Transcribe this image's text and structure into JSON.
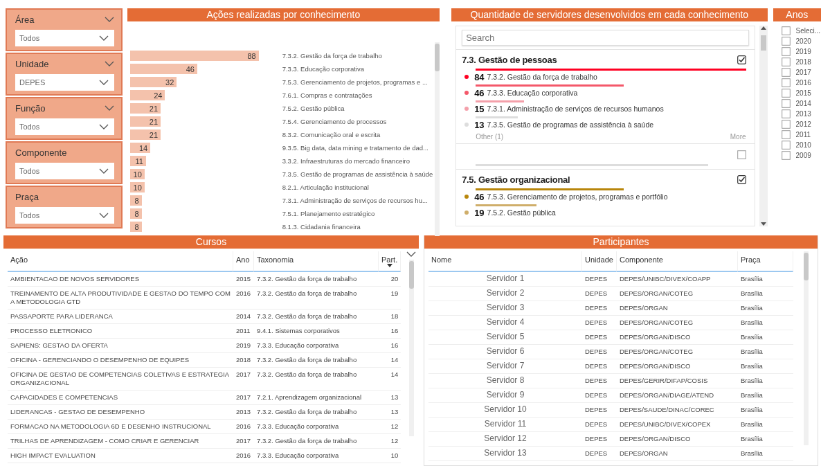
{
  "filters": [
    {
      "label": "Área",
      "value": "Todos",
      "collapse_caret": true
    },
    {
      "label": "Unidade",
      "value": "DEPES",
      "collapse_caret": true
    },
    {
      "label": "Função",
      "value": "Todos",
      "collapse_caret": true
    },
    {
      "label": "Componente",
      "value": "Todos",
      "collapse_caret": false
    },
    {
      "label": "Praça",
      "value": "Todos",
      "collapse_caret": false
    }
  ],
  "actions_chart": {
    "title": "Ações realizadas por conhecimento",
    "chart_data": {
      "type": "bar",
      "orientation": "horizontal",
      "data_labels": true,
      "categories": [
        "7.3.2. Gestão da força de trabalho",
        "7.3.3. Educação corporativa",
        "7.5.3. Gerenciamento de projetos, programas e ...",
        "7.6.1. Compras e contratações",
        "7.5.2. Gestão pública",
        "7.5.4. Gerenciamento de processos",
        "8.3.2. Comunicação oral e escrita",
        "9.3.5. Big data, data mining e tratamento de dad...",
        "3.3.2. Infraestruturas do mercado financeiro",
        "7.3.5. Gestão de programas de assistência à saúde",
        "8.2.1. Articulação institucional",
        "7.3.1. Administração de serviços de recursos hu...",
        "7.5.1. Planejamento estratégico",
        "8.1.3. Cidadania financeira"
      ],
      "series": [
        {
          "color": "#f4c2ac",
          "values": [
            88,
            46,
            32,
            24,
            21,
            21,
            21,
            14,
            11,
            10,
            10,
            8,
            8,
            8
          ]
        }
      ]
    }
  },
  "knowledge": {
    "title": "Quantidade de servidores desenvolvidos em cada conhecimento",
    "search": {
      "placeholder": "Search"
    },
    "groups": [
      {
        "name": "7.3. Gestão de pessoas",
        "checked": true,
        "other": "Other (1)",
        "more": "More",
        "items": [
          {
            "count": "84",
            "label": "7.3.2. Gestão da força de trabalho",
            "color": "#ff0022"
          },
          {
            "count": "46",
            "label": "7.3.3. Educação corporativa",
            "color": "#f4586a"
          },
          {
            "count": "15",
            "label": "7.3.1. Administração de serviços de recursos humanos",
            "color": "#f4a0aa"
          },
          {
            "count": "13",
            "label": "7.3.5. Gestão de programas de assistência à saúde",
            "color": "#dddddd"
          }
        ]
      },
      {
        "checked": false
      },
      {
        "name": "7.5. Gestão organizacional",
        "checked": true,
        "items": [
          {
            "count": "46",
            "label": "7.5.3. Gerenciamento de projetos, programas e portfólio",
            "color": "#b8860b"
          },
          {
            "count": "19",
            "label": "7.5.2. Gestão pública",
            "color": "#cfae6a"
          }
        ]
      }
    ]
  },
  "years": {
    "title": "Anos",
    "items": [
      {
        "label": "Seleci...",
        "checked": false
      },
      {
        "label": "2020",
        "checked": false
      },
      {
        "label": "2019",
        "checked": false
      },
      {
        "label": "2018",
        "checked": false
      },
      {
        "label": "2017",
        "checked": false
      },
      {
        "label": "2016",
        "checked": false
      },
      {
        "label": "2015",
        "checked": false
      },
      {
        "label": "2014",
        "checked": false
      },
      {
        "label": "2013",
        "checked": false
      },
      {
        "label": "2012",
        "checked": false
      },
      {
        "label": "2011",
        "checked": false
      },
      {
        "label": "2010",
        "checked": false
      },
      {
        "label": "2009",
        "checked": false
      }
    ]
  },
  "courses": {
    "title": "Cursos",
    "columns": [
      {
        "label": "Ação",
        "sorted": false
      },
      {
        "label": "Ano",
        "sorted": false
      },
      {
        "label": "Taxonomia",
        "sorted": false
      },
      {
        "label": "Part.",
        "sorted": true
      }
    ],
    "rows": [
      [
        "AMBIENTACAO DE NOVOS SERVIDORES",
        "2015",
        "7.3.2. Gestão da força de trabalho",
        "20"
      ],
      [
        "TREINAMENTO DE ALTA PRODUTIVIDADE E GESTAO DO TEMPO COM A METODOLOGIA GTD",
        "2016",
        "7.3.2. Gestão da força de trabalho",
        "19"
      ],
      [
        "PASSAPORTE PARA LIDERANCA",
        "2014",
        "7.3.2. Gestão da força de trabalho",
        "18"
      ],
      [
        "PROCESSO ELETRONICO",
        "2011",
        "9.4.1. Sistemas corporativos",
        "16"
      ],
      [
        "SAPIENS: GESTAO DA OFERTA",
        "2019",
        "7.3.3. Educação corporativa",
        "16"
      ],
      [
        "OFICINA - GERENCIANDO O DESEMPENHO DE EQUIPES",
        "2018",
        "7.3.2. Gestão da força de trabalho",
        "14"
      ],
      [
        "OFICINA DE GESTAO DE COMPETENCIAS COLETIVAS E ESTRATEGIA ORGANIZACIONAL",
        "2017",
        "7.3.2. Gestão da força de trabalho",
        "14"
      ],
      [
        "CAPACIDADES E COMPETENCIAS",
        "2017",
        "7.2.1. Aprendizagem organizacional",
        "13"
      ],
      [
        "LIDERANCAS - GESTAO DE DESEMPENHO",
        "2013",
        "7.3.2. Gestão da força de trabalho",
        "13"
      ],
      [
        "FORMACAO NA METODOLOGIA 6D E DESENHO INSTRUCIONAL",
        "2016",
        "7.3.3. Educação corporativa",
        "12"
      ],
      [
        "TRILHAS DE APRENDIZAGEM - COMO CRIAR E GERENCIAR",
        "2017",
        "7.3.2. Gestão da força de trabalho",
        "12"
      ],
      [
        "HIGH IMPACT EVALUATION",
        "2016",
        "7.3.3. Educação corporativa",
        "10"
      ]
    ]
  },
  "participants": {
    "title": "Participantes",
    "columns": [
      "Nome",
      "Unidade",
      "Componente",
      "Praça"
    ],
    "rows": [
      [
        "Servidor 1",
        "DEPES",
        "DEPES/UNIBC/DIVEX/COAPP",
        "Brasília"
      ],
      [
        "Servidor 2",
        "DEPES",
        "DEPES/ORGAN/COTEG",
        "Brasília"
      ],
      [
        "Servidor 3",
        "DEPES",
        "DEPES/ORGAN",
        "Brasília"
      ],
      [
        "Servidor 4",
        "DEPES",
        "DEPES/ORGAN/COTEG",
        "Brasília"
      ],
      [
        "Servidor 5",
        "DEPES",
        "DEPES/ORGAN/DISCO",
        "Brasília"
      ],
      [
        "Servidor 6",
        "DEPES",
        "DEPES/ORGAN/COTEG",
        "Brasília"
      ],
      [
        "Servidor 7",
        "DEPES",
        "DEPES/ORGAN/DISCO",
        "Brasília"
      ],
      [
        "Servidor 8",
        "DEPES",
        "DEPES/GERIR/DIFAP/COSIS",
        "Brasília"
      ],
      [
        "Servidor 9",
        "DEPES",
        "DEPES/ORGAN/DIAGE/ATEND",
        "Brasília"
      ],
      [
        "Servidor 10",
        "DEPES",
        "DEPES/SAUDE/DINAC/COREC",
        "Brasília"
      ],
      [
        "Servidor 11",
        "DEPES",
        "DEPES/UNIBC/DIVEX/COPEX",
        "Brasília"
      ],
      [
        "Servidor 12",
        "DEPES",
        "DEPES/ORGAN/DISCO",
        "Brasília"
      ],
      [
        "Servidor 13",
        "DEPES",
        "DEPES/ORGAN",
        "Brasília"
      ]
    ]
  }
}
